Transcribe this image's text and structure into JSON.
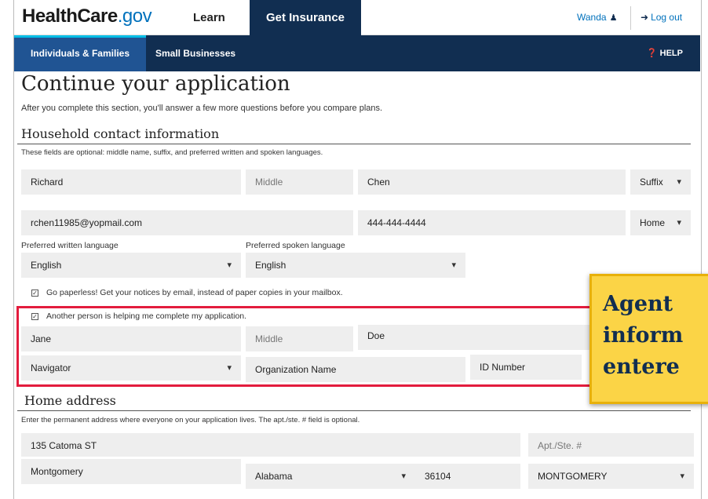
{
  "header": {
    "logo_main": "HealthCare",
    "logo_tld": ".gov",
    "nav_learn": "Learn",
    "nav_get_insurance": "Get Insurance",
    "user_name": "Wanda",
    "logout": "Log out"
  },
  "subnav": {
    "individuals": "Individuals & Families",
    "small_business": "Small Businesses",
    "help": "HELP"
  },
  "page": {
    "title": "Continue your application",
    "intro": "After you complete this section, you'll answer a few more questions before you compare plans."
  },
  "contact": {
    "heading": "Household contact information",
    "note": "These fields are optional: middle name, suffix, and preferred written and spoken languages.",
    "first_name": "Richard",
    "middle_placeholder": "Middle",
    "last_name": "Chen",
    "suffix_placeholder": "Suffix",
    "email": "rchen11985@yopmail.com",
    "phone": "444-444-4444",
    "phone_type": "Home",
    "written_label": "Preferred written language",
    "written_value": "English",
    "spoken_label": "Preferred spoken language",
    "spoken_value": "English",
    "paperless_label": "Go paperless! Get your notices by email, instead of paper copies in your mailbox.",
    "helper_label": "Another person is helping me complete my application."
  },
  "helper": {
    "first_name": "Jane",
    "middle_placeholder": "Middle",
    "last_name": "Doe",
    "role": "Navigator",
    "org_placeholder": "Organization Name",
    "id_placeholder": "ID Number"
  },
  "address": {
    "heading": "Home address",
    "note": "Enter the permanent address where everyone on your application lives. The apt./ste. # field is optional.",
    "street": "135 Catoma ST",
    "apt_placeholder": "Apt./Ste. #",
    "city": "Montgomery",
    "state": "Alabama",
    "zip": "36104",
    "county": "MONTGOMERY"
  },
  "callout": {
    "line1": "Agent",
    "line2": "inform",
    "line3": "entere"
  },
  "colors": {
    "navy": "#112e51",
    "link_blue": "#0071bc",
    "highlight_red": "#e31c3d",
    "callout_yellow": "#fbd446"
  }
}
